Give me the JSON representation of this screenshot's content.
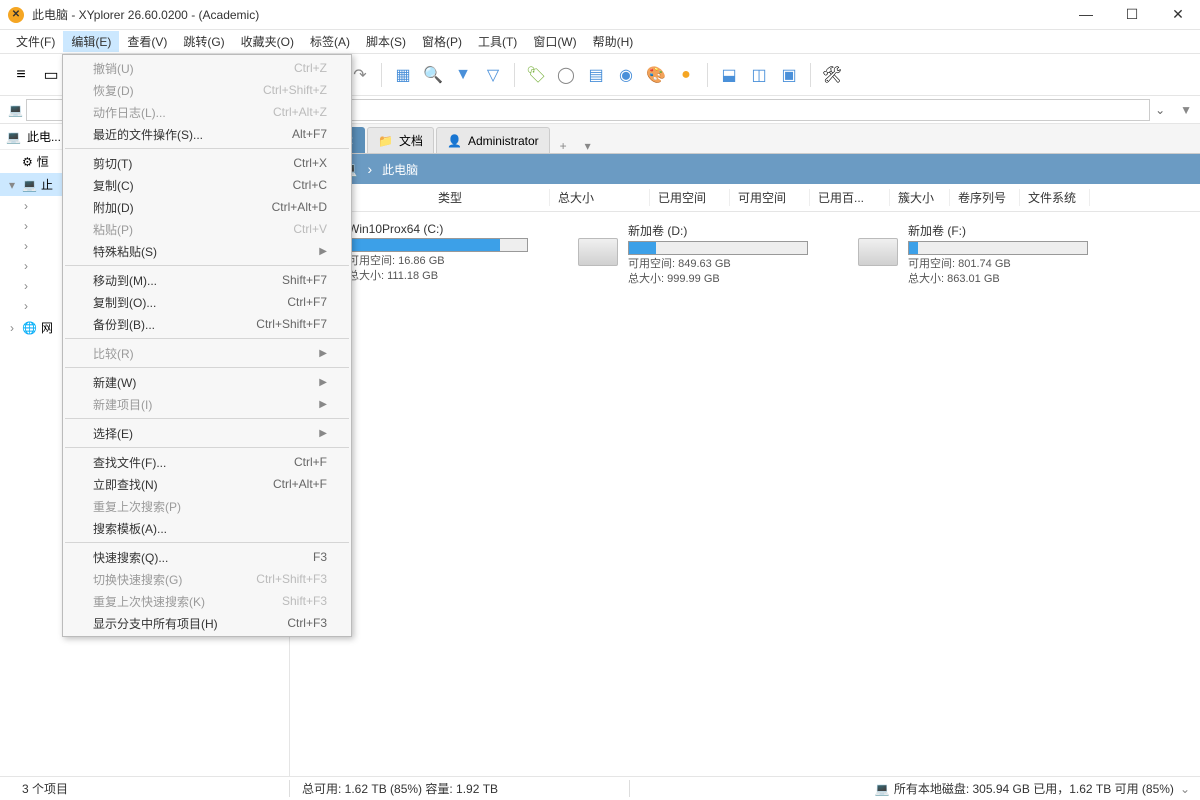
{
  "title": "此电脑 - XYplorer 26.60.0200 - (Academic)",
  "menubar": [
    "文件(F)",
    "编辑(E)",
    "查看(V)",
    "跳转(G)",
    "收藏夹(O)",
    "标签(A)",
    "脚本(S)",
    "窗格(P)",
    "工具(T)",
    "窗口(W)",
    "帮助(H)"
  ],
  "active_menu_index": 1,
  "sidebar": {
    "top_label": "此电...",
    "nodes": [
      {
        "icon": "⚙",
        "label": "恒"
      },
      {
        "icon": "💻",
        "label": "止",
        "expand": "▾",
        "selected": true
      },
      {
        "icon": "",
        "label": "",
        "expand": "›",
        "indent": 1
      },
      {
        "icon": "",
        "label": "",
        "expand": "›",
        "indent": 1
      },
      {
        "icon": "",
        "label": "",
        "expand": "›",
        "indent": 1
      },
      {
        "icon": "",
        "label": "",
        "expand": "›",
        "indent": 1
      },
      {
        "icon": "",
        "label": "",
        "expand": "›",
        "indent": 1
      },
      {
        "icon": "",
        "label": "",
        "expand": "›",
        "indent": 1
      },
      {
        "icon": "🌐",
        "label": "网",
        "expand": "›"
      }
    ]
  },
  "tabs": [
    {
      "icon": "💻",
      "label": "脑",
      "active": true,
      "closable": true
    },
    {
      "icon": "📁",
      "label": "文档",
      "active": false
    },
    {
      "icon": "👤",
      "label": "Administrator",
      "active": false
    }
  ],
  "pathbar": {
    "segments": [
      "此电脑"
    ]
  },
  "columns": [
    "类型",
    "总大小",
    "已用空间",
    "可用空间",
    "已用百...",
    "簇大小",
    "卷序列号",
    "文件系统"
  ],
  "drives": [
    {
      "name": "Win10Prox64 (C:)",
      "fill": 85,
      "free": "可用空间: 16.86 GB",
      "total": "总大小: 111.18 GB"
    },
    {
      "name": "新加卷 (D:)",
      "fill": 15,
      "free": "可用空间: 849.63 GB",
      "total": "总大小: 999.99 GB"
    },
    {
      "name": "新加卷 (F:)",
      "fill": 5,
      "free": "可用空间: 801.74 GB",
      "total": "总大小: 863.01 GB"
    }
  ],
  "statusbar": {
    "items": "3 个项目",
    "summary": "总可用: 1.62 TB (85%)   容量: 1.92 TB",
    "disks": "所有本地磁盘: 305.94 GB 已用，1.62 TB 可用 (85%)"
  },
  "dropdown": [
    {
      "label": "撤销(U)",
      "short": "Ctrl+Z",
      "disabled": true
    },
    {
      "label": "恢复(D)",
      "short": "Ctrl+Shift+Z",
      "disabled": true
    },
    {
      "label": "动作日志(L)...",
      "short": "Ctrl+Alt+Z",
      "disabled": true
    },
    {
      "label": "最近的文件操作(S)...",
      "short": "Alt+F7"
    },
    {
      "sep": true
    },
    {
      "label": "剪切(T)",
      "short": "Ctrl+X"
    },
    {
      "label": "复制(C)",
      "short": "Ctrl+C"
    },
    {
      "label": "附加(D)",
      "short": "Ctrl+Alt+D"
    },
    {
      "label": "粘贴(P)",
      "short": "Ctrl+V",
      "disabled": true
    },
    {
      "label": "特殊粘贴(S)",
      "arrow": true
    },
    {
      "sep": true
    },
    {
      "label": "移动到(M)...",
      "short": "Shift+F7"
    },
    {
      "label": "复制到(O)...",
      "short": "Ctrl+F7"
    },
    {
      "label": "备份到(B)...",
      "short": "Ctrl+Shift+F7"
    },
    {
      "sep": true
    },
    {
      "label": "比较(R)",
      "arrow": true,
      "disabled": true
    },
    {
      "sep": true
    },
    {
      "label": "新建(W)",
      "arrow": true
    },
    {
      "label": "新建项目(I)",
      "arrow": true,
      "disabled": true
    },
    {
      "sep": true
    },
    {
      "label": "选择(E)",
      "arrow": true
    },
    {
      "sep": true
    },
    {
      "label": "查找文件(F)...",
      "short": "Ctrl+F"
    },
    {
      "label": "立即查找(N)",
      "short": "Ctrl+Alt+F"
    },
    {
      "label": "重复上次搜索(P)",
      "disabled": true
    },
    {
      "label": "搜索模板(A)..."
    },
    {
      "sep": true
    },
    {
      "label": "快速搜索(Q)...",
      "short": "F3"
    },
    {
      "label": "切换快速搜索(G)",
      "short": "Ctrl+Shift+F3",
      "disabled": true
    },
    {
      "label": "重复上次快速搜索(K)",
      "short": "Shift+F3",
      "disabled": true
    },
    {
      "label": "显示分支中所有项目(H)",
      "short": "Ctrl+F3"
    }
  ]
}
